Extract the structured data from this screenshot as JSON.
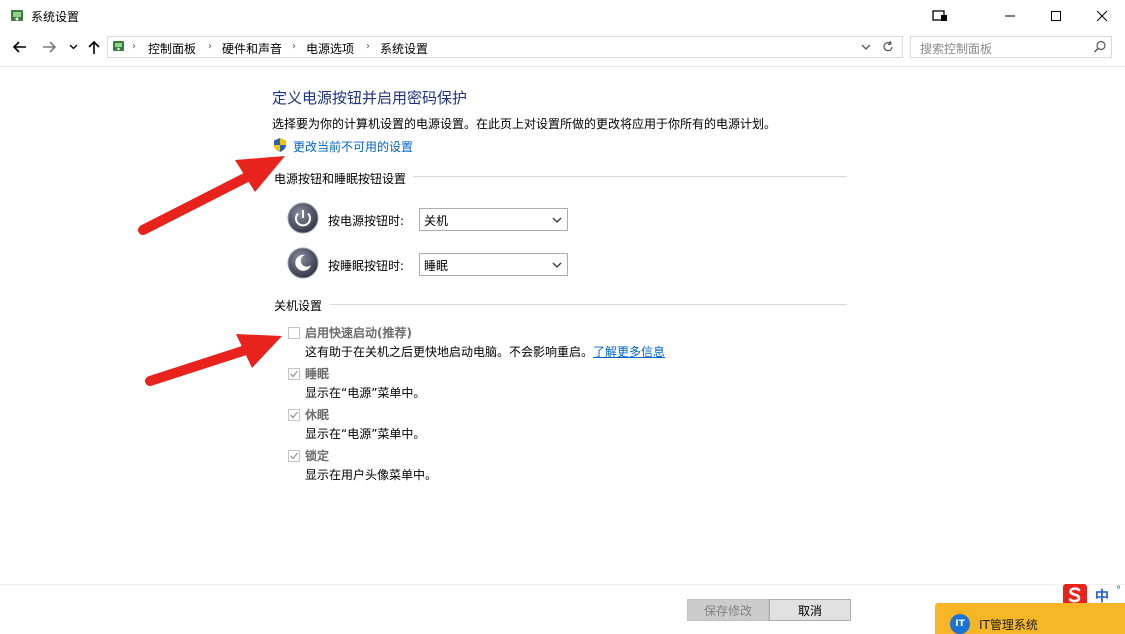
{
  "window": {
    "title": "系统设置"
  },
  "nav": {
    "breadcrumbs": [
      "控制面板",
      "硬件和声音",
      "电源选项",
      "系统设置"
    ],
    "search_placeholder": "搜索控制面板"
  },
  "main": {
    "title": "定义电源按钮并启用密码保护",
    "description": "选择要为你的计算机设置的电源设置。在此页上对设置所做的更改将应用于你所有的电源计划。",
    "change_link": "更改当前不可用的设置",
    "power_section": {
      "title": "电源按钮和睡眠按钮设置",
      "rows": [
        {
          "label": "按电源按钮时:",
          "value": "关机"
        },
        {
          "label": "按睡眠按钮时:",
          "value": "睡眠"
        }
      ]
    },
    "shutdown_section": {
      "title": "关机设置",
      "items": [
        {
          "label": "启用快速启动(推荐)",
          "checked": false,
          "desc": "这有助于在关机之后更快地启动电脑。不会影响重启。",
          "link": "了解更多信息"
        },
        {
          "label": "睡眠",
          "checked": true,
          "desc": "显示在“电源”菜单中。"
        },
        {
          "label": "休眠",
          "checked": true,
          "desc": "显示在“电源”菜单中。"
        },
        {
          "label": "锁定",
          "checked": true,
          "desc": "显示在用户头像菜单中。"
        }
      ]
    }
  },
  "footer": {
    "save_label": "保存修改",
    "cancel_label": "取消"
  },
  "overlay": {
    "ime_label": "中",
    "badge_label": "IT管理系统",
    "badge_icon_text": "IT"
  },
  "colors": {
    "title_blue": "#1e3287",
    "link_blue": "#0066cc",
    "annotation_red": "#e8231e",
    "badge_orange": "#f6b625"
  }
}
